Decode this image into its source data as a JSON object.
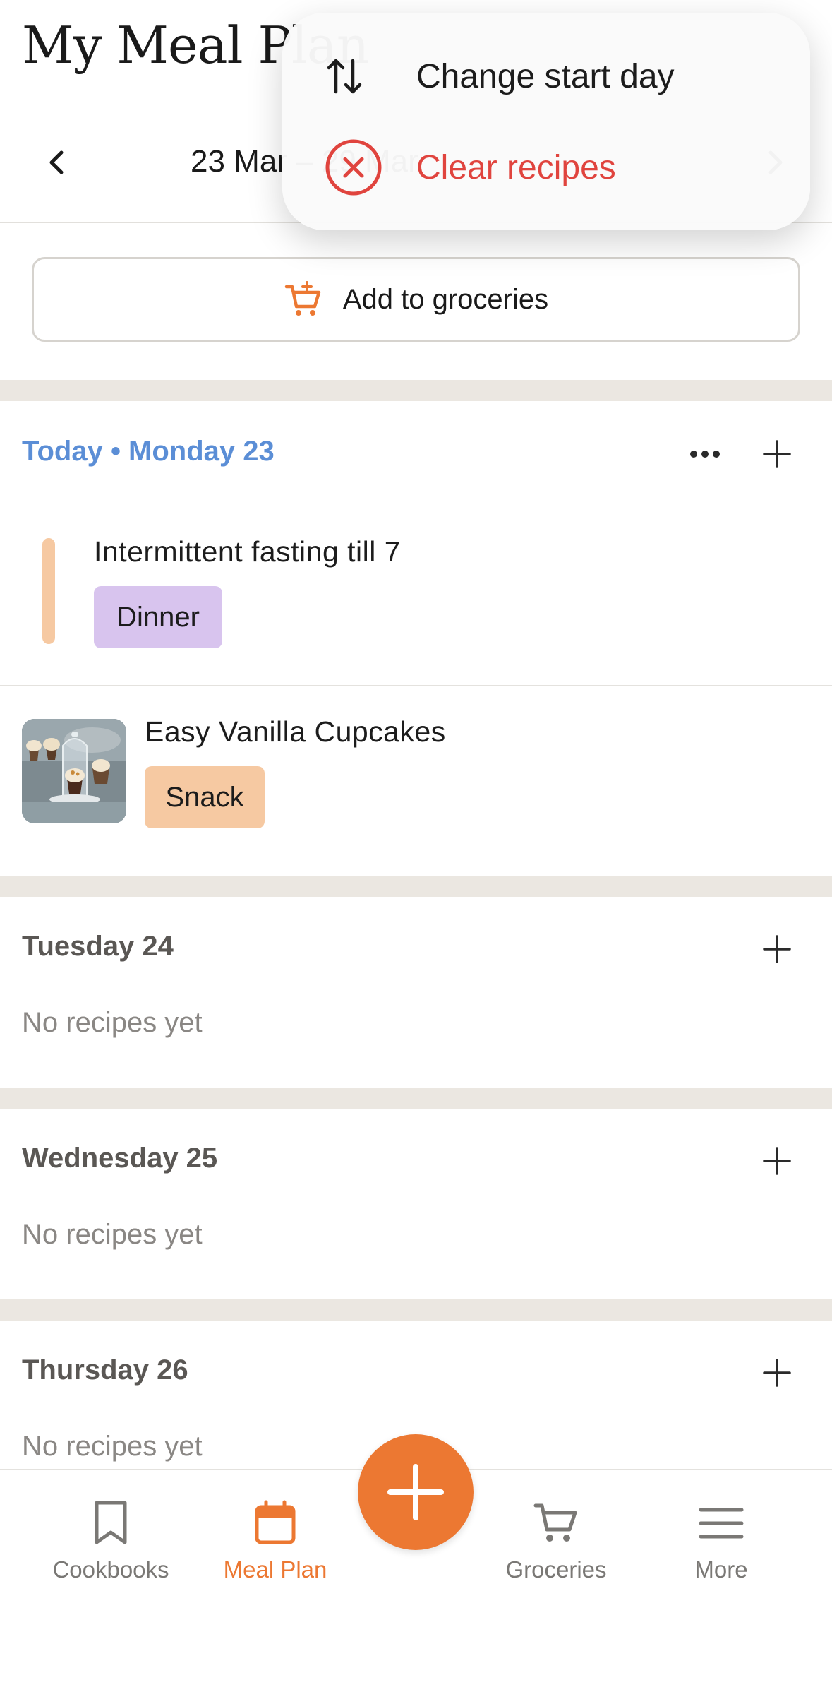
{
  "header": {
    "title": "My Meal Plan",
    "week_label": "23 Mar – 29 Mar"
  },
  "menu": {
    "items": [
      {
        "label": "Change start day",
        "icon": "arrows-up-down-icon"
      },
      {
        "label": "Clear recipes",
        "icon": "x-circle-icon",
        "color": "#e0443e"
      }
    ]
  },
  "groceries_button": {
    "label": "Add to groceries",
    "icon": "cart-plus-icon"
  },
  "days": [
    {
      "header": "Today • Monday 23",
      "items": [
        {
          "title": "Intermittent fasting till 7",
          "tag": "Dinner"
        },
        {
          "title": "Easy Vanilla Cupcakes",
          "tag": "Snack"
        }
      ]
    },
    {
      "header": "Tuesday 24",
      "empty_text": "No recipes yet"
    },
    {
      "header": "Wednesday 25",
      "empty_text": "No recipes yet"
    },
    {
      "header": "Thursday 26",
      "empty_text": "No recipes yet"
    }
  ],
  "tabbar": {
    "tabs": [
      {
        "label": "Cookbooks",
        "icon": "bookmark-icon"
      },
      {
        "label": "Meal Plan",
        "icon": "calendar-icon",
        "active": true
      },
      {
        "label": "Groceries",
        "icon": "cart-icon"
      },
      {
        "label": "More",
        "icon": "menu-icon"
      }
    ]
  },
  "colors": {
    "accent": "#ec7832",
    "today": "#5b8ed6",
    "danger": "#e0443e",
    "dinner_tag": "#d8c4ee",
    "snack_tag": "#f6c9a2"
  }
}
